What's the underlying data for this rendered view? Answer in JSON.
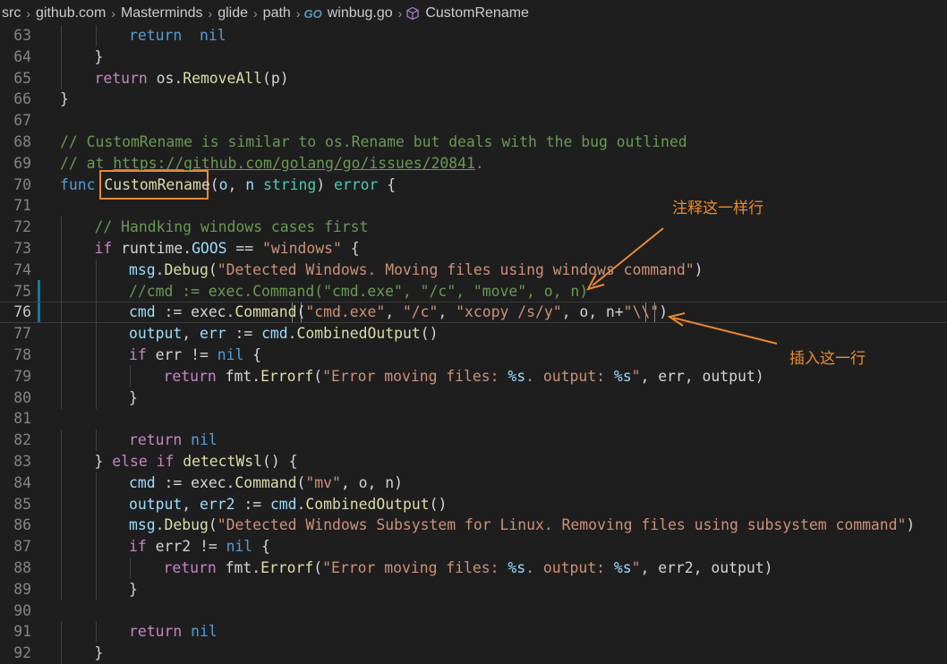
{
  "breadcrumb": {
    "items": [
      "src",
      "github.com",
      "Masterminds",
      "glide",
      "path"
    ],
    "file_icon": "go-file-icon",
    "file": "winbug.go",
    "symbol_icon": "cube-symbol-icon",
    "symbol": "CustomRename"
  },
  "annotations": {
    "comment_line": "注释这一样行",
    "insert_line": "插入这一行"
  },
  "lines": [
    {
      "n": "63",
      "indent": 2,
      "tokens": [
        [
          "kw",
          "return"
        ],
        [
          "",
          "  "
        ],
        [
          "kw",
          "nil"
        ]
      ]
    },
    {
      "n": "64",
      "indent": 1,
      "tokens": [
        [
          "",
          "}"
        ]
      ]
    },
    {
      "n": "65",
      "indent": 1,
      "tokens": [
        [
          "ctl",
          "return"
        ],
        [
          "",
          " os."
        ],
        [
          "fn",
          "RemoveAll"
        ],
        [
          "",
          "(p)"
        ]
      ]
    },
    {
      "n": "66",
      "indent": 0,
      "tokens": [
        [
          "",
          "}"
        ]
      ]
    },
    {
      "n": "67",
      "indent": 0,
      "tokens": []
    },
    {
      "n": "68",
      "indent": 0,
      "tokens": [
        [
          "cm",
          "// CustomRename is similar to os.Rename but deals with the bug outlined"
        ]
      ]
    },
    {
      "n": "69",
      "indent": 0,
      "tokens": [
        [
          "cm",
          "// at "
        ],
        [
          "cm url",
          "https://github.com/golang/go/issues/20841"
        ],
        [
          "cm",
          "."
        ]
      ]
    },
    {
      "n": "70",
      "indent": 0,
      "tokens": [
        [
          "kw",
          "func"
        ],
        [
          "",
          " "
        ],
        [
          "fn",
          "CustomRename"
        ],
        [
          "",
          "("
        ],
        [
          "var",
          "o"
        ],
        [
          "",
          ", "
        ],
        [
          "var",
          "n"
        ],
        [
          "",
          " "
        ],
        [
          "ty",
          "string"
        ],
        [
          "",
          ") "
        ],
        [
          "ty",
          "error"
        ],
        [
          "",
          " {"
        ]
      ]
    },
    {
      "n": "71",
      "indent": 0,
      "tokens": []
    },
    {
      "n": "72",
      "indent": 1,
      "tokens": [
        [
          "cm",
          "// Handking windows cases first"
        ]
      ]
    },
    {
      "n": "73",
      "indent": 1,
      "tokens": [
        [
          "ctl",
          "if"
        ],
        [
          "",
          " runtime."
        ],
        [
          "var",
          "GOOS"
        ],
        [
          "",
          " == "
        ],
        [
          "str",
          "\"windows\""
        ],
        [
          "",
          " {"
        ]
      ]
    },
    {
      "n": "74",
      "indent": 2,
      "tokens": [
        [
          "var",
          "msg"
        ],
        [
          "",
          "."
        ],
        [
          "fn",
          "Debug"
        ],
        [
          "",
          "("
        ],
        [
          "str",
          "\"Detected Windows. Moving files using windows command\""
        ],
        [
          "",
          ")"
        ]
      ]
    },
    {
      "n": "75",
      "indent": 2,
      "tokens": [
        [
          "cm",
          "//cmd := exec.Command(\"cmd.exe\", \"/c\", \"move\", o, n)"
        ]
      ]
    },
    {
      "n": "76",
      "indent": 2,
      "tokens": [
        [
          "var",
          "cmd"
        ],
        [
          "",
          " := exec."
        ],
        [
          "fn",
          "Command"
        ],
        [
          "",
          "("
        ],
        [
          "str",
          "\"cmd.exe\""
        ],
        [
          "",
          ", "
        ],
        [
          "str",
          "\"/c\""
        ],
        [
          "",
          ", "
        ],
        [
          "str",
          "\"xcopy /s/y\""
        ],
        [
          "",
          ", o, n+"
        ],
        [
          "str",
          "\"\\\\\""
        ],
        [
          "",
          ")"
        ]
      ]
    },
    {
      "n": "77",
      "indent": 2,
      "tokens": [
        [
          "var",
          "output"
        ],
        [
          "",
          ", "
        ],
        [
          "var",
          "err"
        ],
        [
          "",
          " := "
        ],
        [
          "var",
          "cmd"
        ],
        [
          "",
          "."
        ],
        [
          "fn",
          "CombinedOutput"
        ],
        [
          "",
          "()"
        ]
      ]
    },
    {
      "n": "78",
      "indent": 2,
      "tokens": [
        [
          "ctl",
          "if"
        ],
        [
          "",
          " err != "
        ],
        [
          "kw",
          "nil"
        ],
        [
          "",
          " {"
        ]
      ]
    },
    {
      "n": "79",
      "indent": 3,
      "tokens": [
        [
          "ctl",
          "return"
        ],
        [
          "",
          " fmt."
        ],
        [
          "fn",
          "Errorf"
        ],
        [
          "",
          "("
        ],
        [
          "str",
          "\"Error moving files: "
        ],
        [
          "fmt",
          "%s"
        ],
        [
          "str",
          ". output: "
        ],
        [
          "fmt",
          "%s"
        ],
        [
          "str",
          "\""
        ],
        [
          "",
          ", err, output)"
        ]
      ]
    },
    {
      "n": "80",
      "indent": 2,
      "tokens": [
        [
          "",
          "}"
        ]
      ]
    },
    {
      "n": "81",
      "indent": 0,
      "tokens": []
    },
    {
      "n": "82",
      "indent": 2,
      "tokens": [
        [
          "ctl",
          "return"
        ],
        [
          "",
          " "
        ],
        [
          "kw",
          "nil"
        ]
      ]
    },
    {
      "n": "83",
      "indent": 1,
      "tokens": [
        [
          "",
          "} "
        ],
        [
          "ctl",
          "else if"
        ],
        [
          "",
          " "
        ],
        [
          "fn",
          "detectWsl"
        ],
        [
          "",
          "() {"
        ]
      ]
    },
    {
      "n": "84",
      "indent": 2,
      "tokens": [
        [
          "var",
          "cmd"
        ],
        [
          "",
          " := exec."
        ],
        [
          "fn",
          "Command"
        ],
        [
          "",
          "("
        ],
        [
          "str",
          "\"mv\""
        ],
        [
          "",
          ", o, n)"
        ]
      ]
    },
    {
      "n": "85",
      "indent": 2,
      "tokens": [
        [
          "var",
          "output"
        ],
        [
          "",
          ", "
        ],
        [
          "var",
          "err2"
        ],
        [
          "",
          " := "
        ],
        [
          "var",
          "cmd"
        ],
        [
          "",
          "."
        ],
        [
          "fn",
          "CombinedOutput"
        ],
        [
          "",
          "()"
        ]
      ]
    },
    {
      "n": "86",
      "indent": 2,
      "tokens": [
        [
          "var",
          "msg"
        ],
        [
          "",
          "."
        ],
        [
          "fn",
          "Debug"
        ],
        [
          "",
          "("
        ],
        [
          "str",
          "\"Detected Windows Subsystem for Linux. Removing files using subsystem command\""
        ],
        [
          "",
          ")"
        ]
      ]
    },
    {
      "n": "87",
      "indent": 2,
      "tokens": [
        [
          "ctl",
          "if"
        ],
        [
          "",
          " err2 != "
        ],
        [
          "kw",
          "nil"
        ],
        [
          "",
          " {"
        ]
      ]
    },
    {
      "n": "88",
      "indent": 3,
      "tokens": [
        [
          "ctl",
          "return"
        ],
        [
          "",
          " fmt."
        ],
        [
          "fn",
          "Errorf"
        ],
        [
          "",
          "("
        ],
        [
          "str",
          "\"Error moving files: "
        ],
        [
          "fmt",
          "%s"
        ],
        [
          "str",
          ". output: "
        ],
        [
          "fmt",
          "%s"
        ],
        [
          "str",
          "\""
        ],
        [
          "",
          ", err2, output)"
        ]
      ]
    },
    {
      "n": "89",
      "indent": 2,
      "tokens": [
        [
          "",
          "}"
        ]
      ]
    },
    {
      "n": "90",
      "indent": 0,
      "tokens": []
    },
    {
      "n": "91",
      "indent": 2,
      "tokens": [
        [
          "ctl",
          "return"
        ],
        [
          "",
          " "
        ],
        [
          "kw",
          "nil"
        ]
      ]
    },
    {
      "n": "92",
      "indent": 1,
      "tokens": [
        [
          "",
          "}"
        ]
      ]
    }
  ]
}
